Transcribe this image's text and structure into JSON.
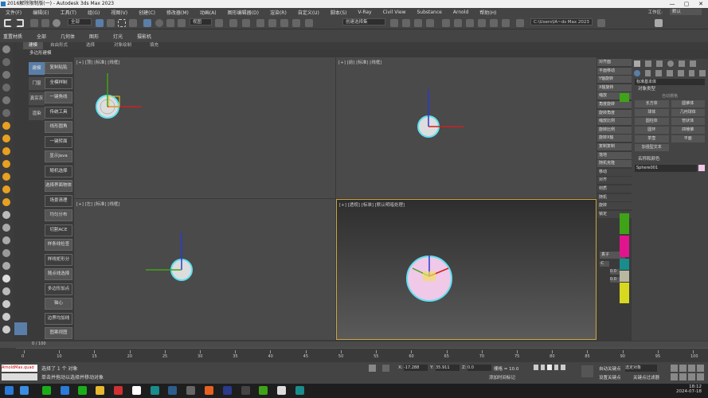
{
  "window": {
    "title": "2016解除限制版(一) - Autodesk 3ds Max 2023",
    "minimize": "—",
    "maximize": "▢",
    "close": "✕"
  },
  "menu": [
    "文件(F)",
    "编辑(E)",
    "工具(T)",
    "组(G)",
    "视图(V)",
    "创建(C)",
    "修改器(M)",
    "动画(A)",
    "图形编辑器(D)",
    "渲染(R)",
    "自定义(U)",
    "脚本(S)",
    "V-Ray",
    "Civil View",
    "Substance",
    "Arnold",
    "帮助(H)"
  ],
  "workspace": {
    "label": "工作区:",
    "value": "默认"
  },
  "toolbar": {
    "filter_dd": "全部",
    "view_dd": "视图",
    "selset_dd": "创建选择集",
    "path": "C:\\Users\\lA~ds Max 2023"
  },
  "ribbon": [
    "重置材质",
    "全部",
    "几何体",
    "图形",
    "灯光",
    "摄影机"
  ],
  "subtabs": [
    "建模",
    "自由形式",
    "选择",
    "对象绘制",
    "填充"
  ],
  "polylabel": "多边形建模",
  "left_tabs": [
    "建模",
    "门窗",
    "真实灰",
    "渲染"
  ],
  "left_buttons": [
    "复制粘贴",
    "全模样制",
    "一键角线",
    "传统工具",
    "线形圆角",
    "一键转面",
    "显示Java",
    "随机选择",
    "选择界面物体",
    "场景清理",
    "均匀分布",
    "切割ACE",
    "样条线检查",
    "样线矩形分",
    "随点线选择",
    "多边形加点",
    "轴心",
    "边界均加线",
    "图案视图"
  ],
  "viewports": {
    "top": "[+] [顶] [标准] [线框]",
    "front": "[+] [前] [标准] [线框]",
    "left": "[+] [左] [标准] [线框]",
    "persp": "[+] [透视] [标准] [默认明暗处理]"
  },
  "right_buttons": [
    "对齐面",
    "平面移动",
    "Y轴旋转",
    "X轴旋转",
    "缩放",
    "角度旋转",
    "旋转角度",
    "缩放比例",
    "旋转比例",
    "旋转X轴",
    "复制复制",
    "落地",
    "随机克隆",
    "移动",
    "对齐",
    "材质",
    "随机",
    "旋转",
    "锁定"
  ],
  "right_buttons2": [
    "对面",
    "旋转",
    "XY",
    "切片",
    "切片",
    "切片",
    "贴图",
    "塌陷",
    "对齐",
    "成组",
    "剂量",
    "切分",
    "封口",
    "工具",
    "展开",
    "摄影",
    "查找",
    "设置"
  ],
  "right_small": [
    "真子",
    "-C",
    "0.0",
    "0.0"
  ],
  "cmd": {
    "dropdown": "标准基本体",
    "section1": "对象类型",
    "auto_grid": "自动栅格",
    "objects": [
      "长方体",
      "圆锥体",
      "球体",
      "几何球体",
      "圆柱体",
      "管状体",
      "圆环",
      "四棱锥",
      "茶壶",
      "平面",
      "加强型文本"
    ],
    "section2": "名称和颜色",
    "name": "Sphere001",
    "color": "#f0c8e8"
  },
  "timeline": {
    "frame": "0 / 100",
    "ticks": [
      "0",
      "10",
      "15",
      "20",
      "25",
      "30",
      "35",
      "40",
      "45",
      "50",
      "55",
      "60",
      "65",
      "70",
      "75",
      "80",
      "85",
      "90",
      "95",
      "100"
    ]
  },
  "status": {
    "line1": "选择了 1 个 对象",
    "line2": "单击并拖动以选择并移动对象",
    "x": "-17.288",
    "y": "35.911",
    "z": "0.0",
    "grid": "栅格 = 10.0",
    "autokey": "自动关键点",
    "setkey": "设置关键点",
    "selobj": "选定对象",
    "keyfilter": "关键点过滤器",
    "addtime": "添加时间标记",
    "script": "ArnoldMax.quad"
  },
  "taskbar": {
    "time": "18:12",
    "date": "2024-07-18"
  },
  "colors": {
    "accent": "#5a7ea8",
    "vp_border": "#c9a640",
    "green": "#3fa318",
    "magenta": "#e0148c",
    "teal": "#1a8c8c",
    "yellow": "#d8d820"
  }
}
